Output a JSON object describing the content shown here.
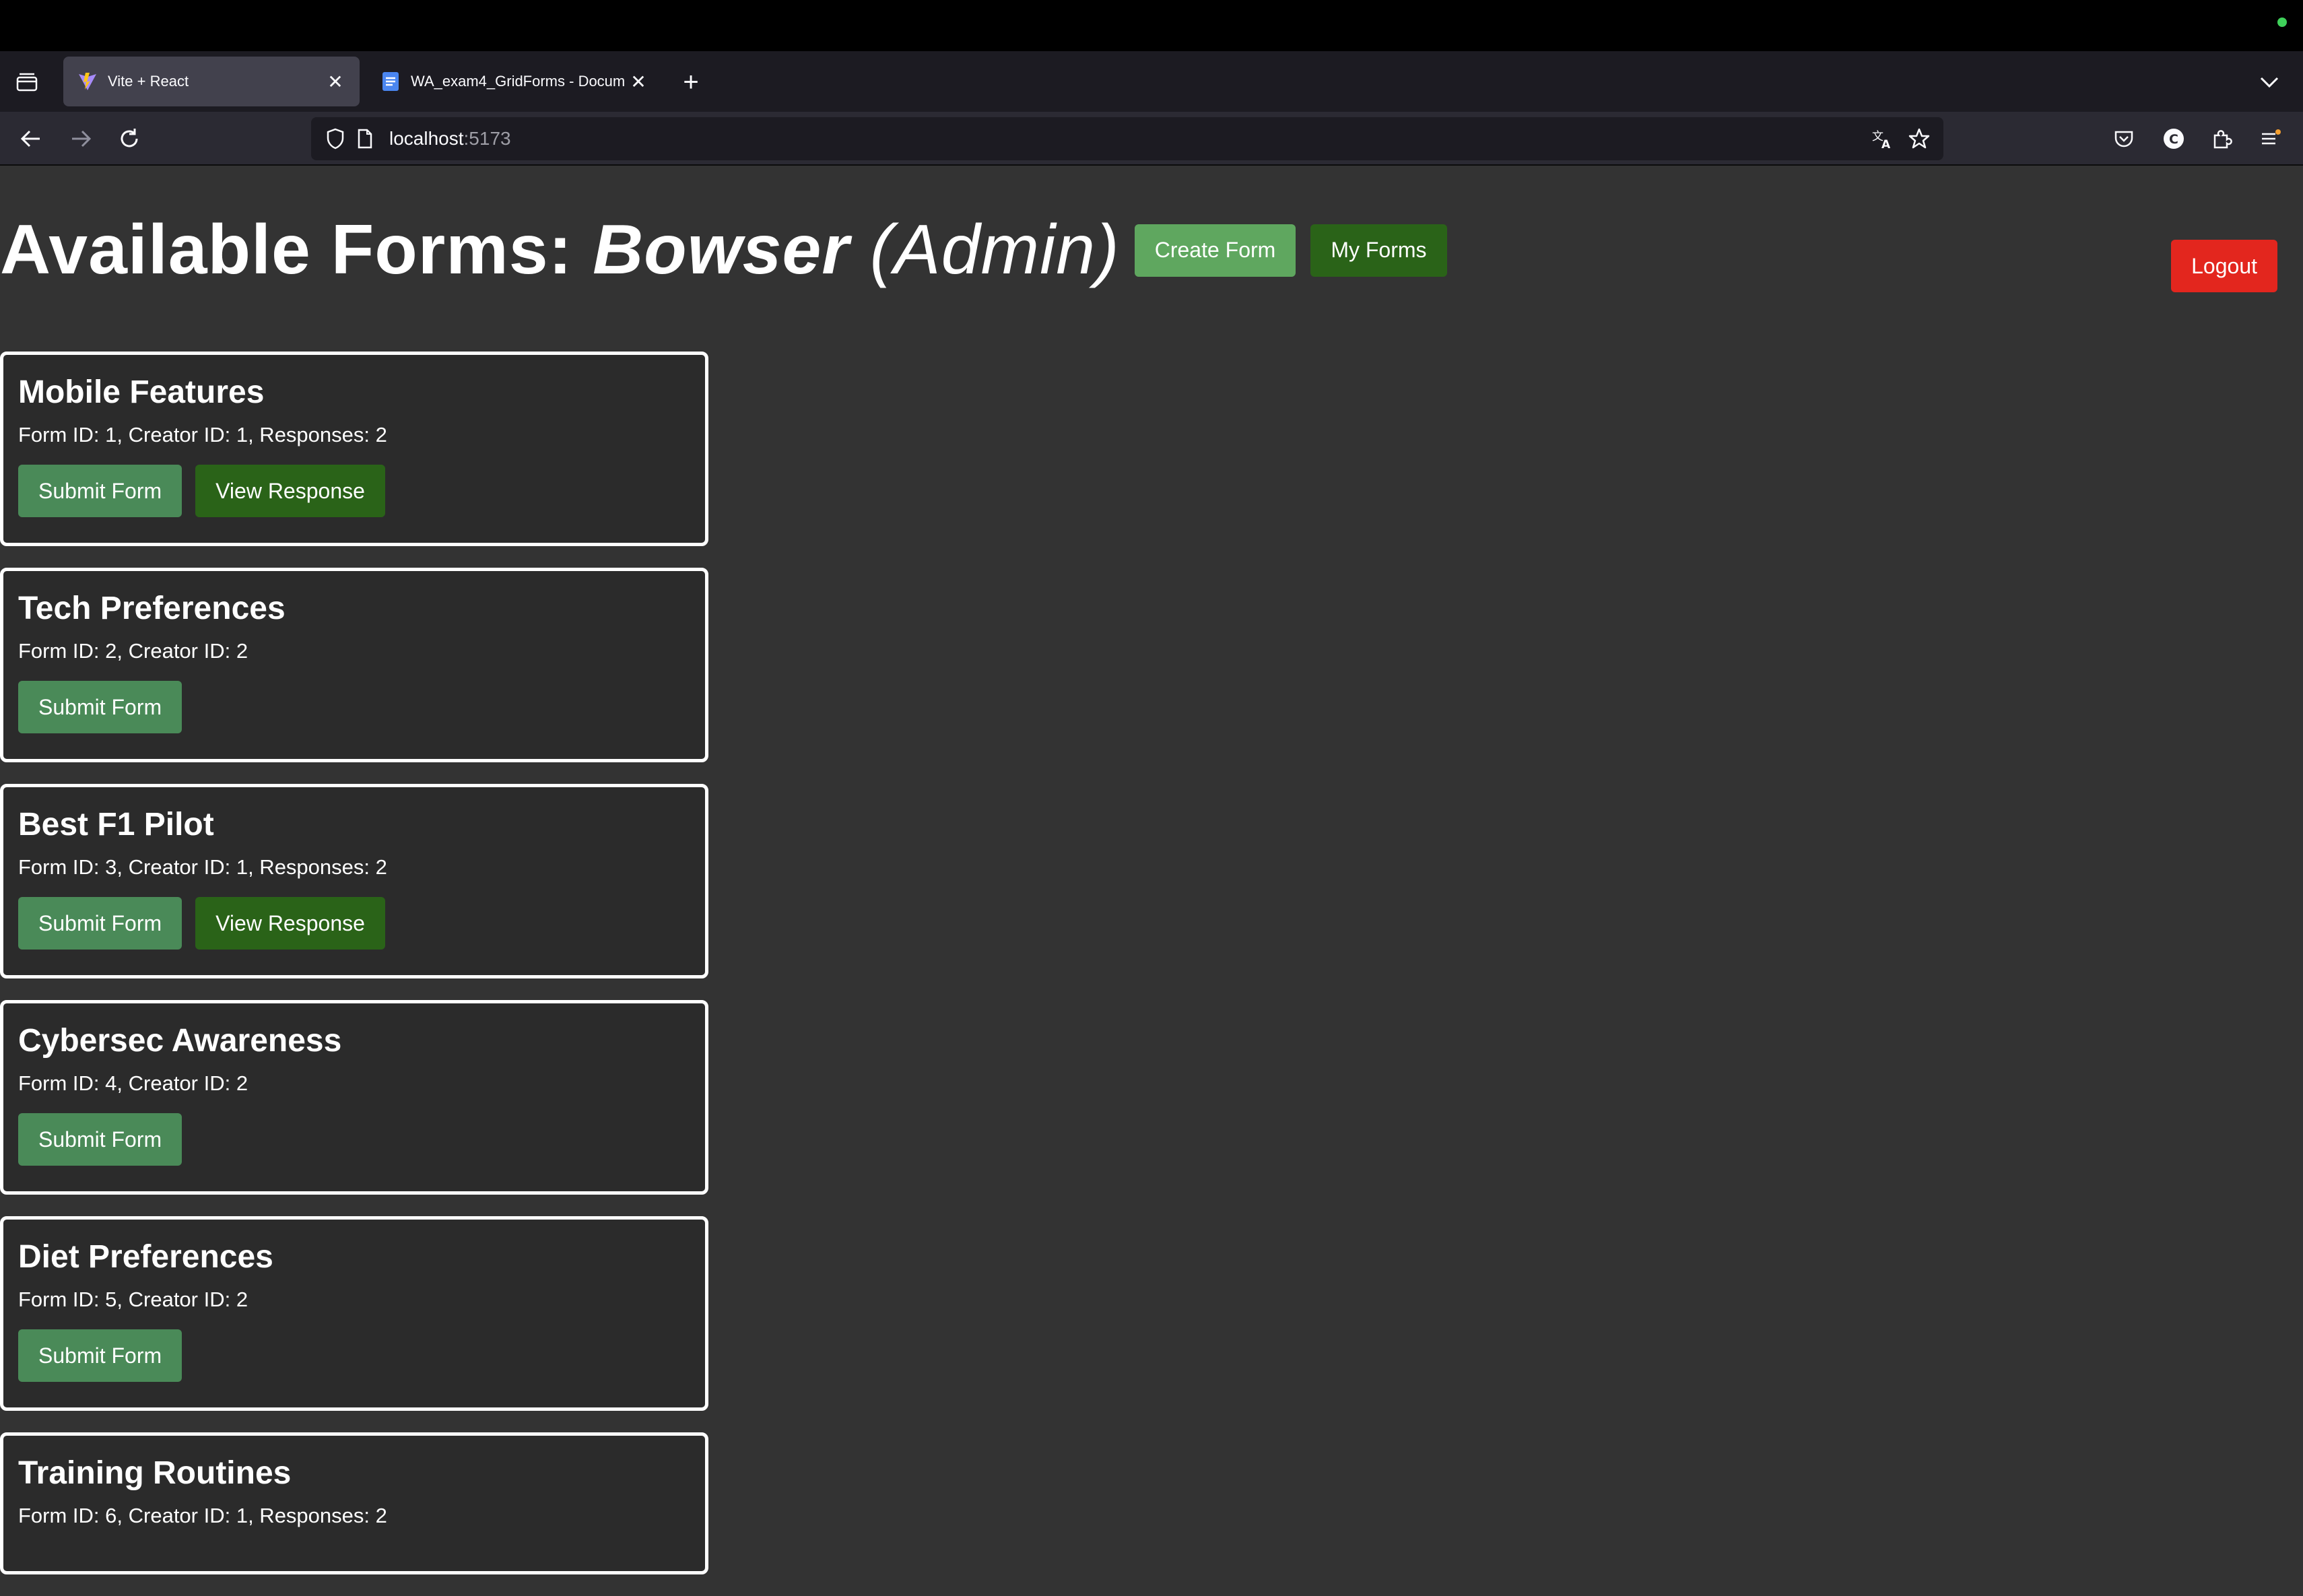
{
  "browser": {
    "tabs": [
      {
        "title": "Vite + React",
        "active": true,
        "icon": "vite-icon"
      },
      {
        "title": "WA_exam4_GridForms - Docum",
        "active": false,
        "icon": "docs-icon"
      }
    ],
    "url": {
      "host": "localhost",
      "port": ":5173"
    }
  },
  "header": {
    "title_prefix": "Available Forms: ",
    "user": "Bowser",
    "role": "(Admin)",
    "create_label": "Create Form",
    "myforms_label": "My Forms",
    "logout_label": "Logout"
  },
  "colors": {
    "background": "#333333",
    "card_border": "#ffffff",
    "create_button": "#5fa75f",
    "dark_green_button": "#2a6318",
    "submit_button": "#4a8a58",
    "logout_button": "#e3261e"
  },
  "forms": [
    {
      "title": "Mobile Features",
      "meta": "Form ID: 1, Creator ID: 1, Responses: 2",
      "submit_label": "Submit Form",
      "view_label": "View Response"
    },
    {
      "title": "Tech Preferences",
      "meta": "Form ID: 2, Creator ID: 2",
      "submit_label": "Submit Form"
    },
    {
      "title": "Best F1 Pilot",
      "meta": "Form ID: 3, Creator ID: 1, Responses: 2",
      "submit_label": "Submit Form",
      "view_label": "View Response"
    },
    {
      "title": "Cybersec Awareness",
      "meta": "Form ID: 4, Creator ID: 2",
      "submit_label": "Submit Form"
    },
    {
      "title": "Diet Preferences",
      "meta": "Form ID: 5, Creator ID: 2",
      "submit_label": "Submit Form"
    },
    {
      "title": "Training Routines",
      "meta": "Form ID: 6, Creator ID: 1, Responses: 2"
    }
  ]
}
